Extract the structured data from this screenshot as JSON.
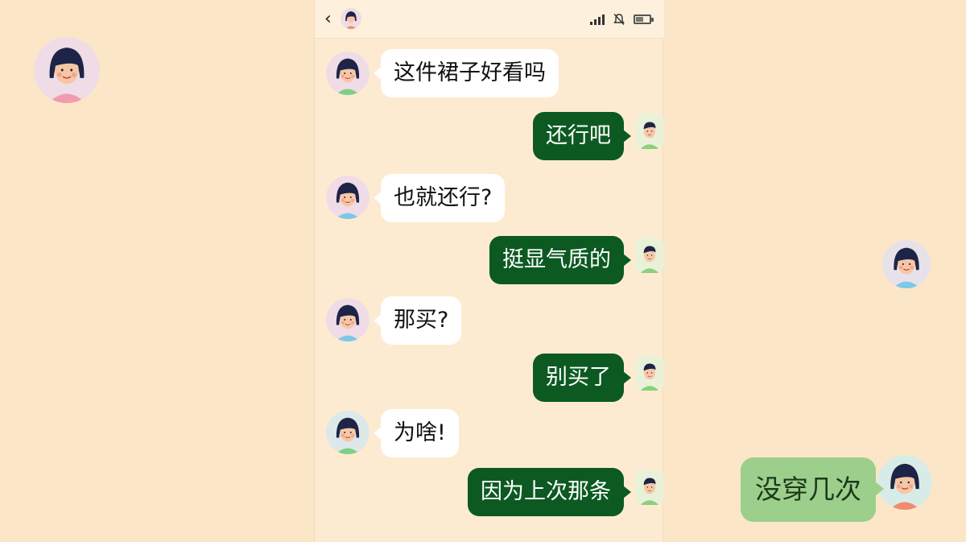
{
  "app": {
    "back_icon": "chevron-left-icon",
    "status_icons": [
      "signal-icon",
      "mute-icon",
      "battery-icon"
    ]
  },
  "messages": [
    {
      "side": "in",
      "text": "这件裙子好看吗",
      "avatar": "woman-avatar"
    },
    {
      "side": "out",
      "text": "还行吧",
      "avatar": "man-avatar"
    },
    {
      "side": "in",
      "text": "也就还行?",
      "avatar": "woman-avatar"
    },
    {
      "side": "out",
      "text": "挺显气质的",
      "avatar": "man-avatar"
    },
    {
      "side": "in",
      "text": "那买?",
      "avatar": "woman-avatar"
    },
    {
      "side": "out",
      "text": "别买了",
      "avatar": "man-avatar"
    },
    {
      "side": "in",
      "text": "为啥!",
      "avatar": "woman-avatar"
    },
    {
      "side": "out",
      "text": "因为上次那条",
      "avatar": "man-avatar"
    }
  ],
  "overlay": {
    "bubble_text": "没穿几次"
  },
  "colors": {
    "background": "#fbe6c8",
    "incoming_bubble": "#ffffff",
    "outgoing_bubble": "#0c5a22",
    "overlay_bubble": "#9ccf8c"
  }
}
